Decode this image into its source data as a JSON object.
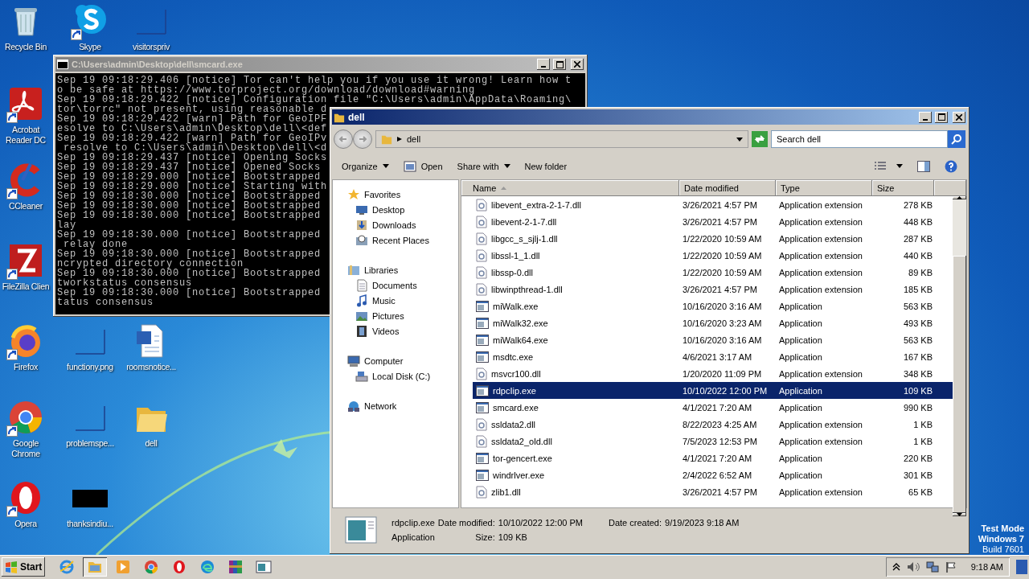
{
  "desktop_icons": [
    {
      "label": "Recycle Bin",
      "kind": "recycle",
      "shortcut": false
    },
    {
      "label": "Skype",
      "kind": "skype",
      "shortcut": true
    },
    {
      "label": "visitorspriv",
      "kind": "blank",
      "shortcut": false
    },
    {
      "label": "Acrobat Reader DC",
      "kind": "acrobat",
      "shortcut": true
    },
    {
      "label": "CCleaner",
      "kind": "ccleaner",
      "shortcut": true
    },
    {
      "label": "FileZilla Clien",
      "kind": "filezilla",
      "shortcut": true
    },
    {
      "label": "Firefox",
      "kind": "firefox",
      "shortcut": true
    },
    {
      "label": "functiony.png",
      "kind": "blank",
      "shortcut": false
    },
    {
      "label": "roomsnotice...",
      "kind": "word",
      "shortcut": false
    },
    {
      "label": "Google Chrome",
      "kind": "chrome",
      "shortcut": true
    },
    {
      "label": "problemspe...",
      "kind": "blank",
      "shortcut": false
    },
    {
      "label": "dell",
      "kind": "folder",
      "shortcut": false
    },
    {
      "label": "Opera",
      "kind": "opera",
      "shortcut": true
    },
    {
      "label": "thanksindiu...",
      "kind": "black",
      "shortcut": false
    }
  ],
  "console": {
    "title": "C:\\Users\\admin\\Desktop\\dell\\smcard.exe",
    "lines": [
      "Sep 19 09:18:29.406 [notice] Tor can't help you if you use it wrong! Learn how t",
      "o be safe at https://www.torproject.org/download/download#warning",
      "Sep 19 09:18:29.422 [notice] Configuration file \"C:\\Users\\admin\\AppData\\Roaming\\",
      "tor\\torrc\" not present, using reasonable d",
      "Sep 19 09:18:29.422 [warn] Path for GeoIPF",
      "esolve to C:\\Users\\admin\\Desktop\\dell\\<def",
      "Sep 19 09:18:29.422 [warn] Path for GeoIPv",
      " resolve to C:\\Users\\admin\\Desktop\\dell\\<d",
      "Sep 19 09:18:29.437 [notice] Opening Socks",
      "Sep 19 09:18:29.437 [notice] Opened Socks",
      "Sep 19 09:18:29.000 [notice] Bootstrapped",
      "Sep 19 09:18:29.000 [notice] Starting with",
      "Sep 19 09:18:30.000 [notice] Bootstrapped",
      "Sep 19 09:18:30.000 [notice] Bootstrapped",
      "Sep 19 09:18:30.000 [notice] Bootstrapped",
      "lay",
      "Sep 19 09:18:30.000 [notice] Bootstrapped",
      " relay done",
      "Sep 19 09:18:30.000 [notice] Bootstrapped",
      "ncrypted directory connection",
      "Sep 19 09:18:30.000 [notice] Bootstrapped",
      "tworkstatus consensus",
      "Sep 19 09:18:30.000 [notice] Bootstrapped",
      "tatus consensus"
    ]
  },
  "explorer": {
    "title": "dell",
    "address": "dell",
    "search_placeholder": "Search dell",
    "toolbar": [
      {
        "label": "Organize",
        "kind": "menu"
      },
      {
        "label": "Open",
        "kind": "open"
      },
      {
        "label": "Share with",
        "kind": "menu"
      },
      {
        "label": "New folder",
        "kind": "plain"
      }
    ],
    "nav": [
      {
        "label": "Favorites",
        "kind": "star",
        "children": [
          {
            "label": "Desktop",
            "kind": "desktop"
          },
          {
            "label": "Downloads",
            "kind": "downloads"
          },
          {
            "label": "Recent Places",
            "kind": "recent"
          }
        ]
      },
      {
        "label": "Libraries",
        "kind": "libraries",
        "children": [
          {
            "label": "Documents",
            "kind": "documents"
          },
          {
            "label": "Music",
            "kind": "music"
          },
          {
            "label": "Pictures",
            "kind": "pictures"
          },
          {
            "label": "Videos",
            "kind": "videos"
          }
        ]
      },
      {
        "label": "Computer",
        "kind": "computer",
        "children": [
          {
            "label": "Local Disk (C:)",
            "kind": "disk"
          }
        ]
      },
      {
        "label": "Network",
        "kind": "network"
      }
    ],
    "columns": [
      {
        "label": "Name",
        "sorted": true
      },
      {
        "label": "Date modified",
        "sorted": false
      },
      {
        "label": "Type",
        "sorted": false
      },
      {
        "label": "Size",
        "sorted": false
      }
    ],
    "files": [
      {
        "name": "libevent_extra-2-1-7.dll",
        "date": "3/26/2021 4:57 PM",
        "type": "Application extension",
        "size": "278 KB",
        "kind": "dll",
        "selected": false
      },
      {
        "name": "libevent-2-1-7.dll",
        "date": "3/26/2021 4:57 PM",
        "type": "Application extension",
        "size": "448 KB",
        "kind": "dll",
        "selected": false
      },
      {
        "name": "libgcc_s_sjlj-1.dll",
        "date": "1/22/2020 10:59 AM",
        "type": "Application extension",
        "size": "287 KB",
        "kind": "dll",
        "selected": false
      },
      {
        "name": "libssl-1_1.dll",
        "date": "1/22/2020 10:59 AM",
        "type": "Application extension",
        "size": "440 KB",
        "kind": "dll",
        "selected": false
      },
      {
        "name": "libssp-0.dll",
        "date": "1/22/2020 10:59 AM",
        "type": "Application extension",
        "size": "89 KB",
        "kind": "dll",
        "selected": false
      },
      {
        "name": "libwinpthread-1.dll",
        "date": "3/26/2021 4:57 PM",
        "type": "Application extension",
        "size": "185 KB",
        "kind": "dll",
        "selected": false
      },
      {
        "name": "miWalk.exe",
        "date": "10/16/2020 3:16 AM",
        "type": "Application",
        "size": "563 KB",
        "kind": "exe",
        "selected": false
      },
      {
        "name": "miWalk32.exe",
        "date": "10/16/2020 3:23 AM",
        "type": "Application",
        "size": "493 KB",
        "kind": "exe",
        "selected": false
      },
      {
        "name": "miWalk64.exe",
        "date": "10/16/2020 3:16 AM",
        "type": "Application",
        "size": "563 KB",
        "kind": "exe",
        "selected": false
      },
      {
        "name": "msdtc.exe",
        "date": "4/6/2021 3:17 AM",
        "type": "Application",
        "size": "167 KB",
        "kind": "exe",
        "selected": false
      },
      {
        "name": "msvcr100.dll",
        "date": "1/20/2020 11:09 PM",
        "type": "Application extension",
        "size": "348 KB",
        "kind": "dll",
        "selected": false
      },
      {
        "name": "rdpcIip.exe",
        "date": "10/10/2022 12:00 PM",
        "type": "Application",
        "size": "109 KB",
        "kind": "exe",
        "selected": true
      },
      {
        "name": "smcard.exe",
        "date": "4/1/2021 7:20 AM",
        "type": "Application",
        "size": "990 KB",
        "kind": "exe",
        "selected": false
      },
      {
        "name": "ssldata2.dll",
        "date": "8/22/2023 4:25 AM",
        "type": "Application extension",
        "size": "1 KB",
        "kind": "dll",
        "selected": false
      },
      {
        "name": "ssldata2_old.dll",
        "date": "7/5/2023 12:53 PM",
        "type": "Application extension",
        "size": "1 KB",
        "kind": "dll",
        "selected": false
      },
      {
        "name": "tor-gencert.exe",
        "date": "4/1/2021 7:20 AM",
        "type": "Application",
        "size": "220 KB",
        "kind": "exe",
        "selected": false
      },
      {
        "name": "windrlver.exe",
        "date": "2/4/2022 6:52 AM",
        "type": "Application",
        "size": "301 KB",
        "kind": "exe",
        "selected": false
      },
      {
        "name": "zlib1.dll",
        "date": "3/26/2021 4:57 PM",
        "type": "Application extension",
        "size": "65 KB",
        "kind": "dll",
        "selected": false
      }
    ],
    "details": {
      "name": "rdpcIip.exe",
      "type": "Application",
      "modified_label": "Date modified:",
      "modified": "10/10/2022 12:00 PM",
      "created_label": "Date created:",
      "created": "9/19/2023 9:18 AM",
      "size_label": "Size:",
      "size": "109 KB"
    }
  },
  "os_notice": [
    "Test Mode",
    "Windows 7",
    "Build 7601"
  ],
  "taskbar": {
    "start": "Start",
    "apps": [
      {
        "kind": "ie",
        "active": false
      },
      {
        "kind": "explorer",
        "active": true
      },
      {
        "kind": "media",
        "active": false
      },
      {
        "kind": "chrome",
        "active": false
      },
      {
        "kind": "opera",
        "active": false
      },
      {
        "kind": "edge",
        "active": false
      },
      {
        "kind": "winrar",
        "active": false
      },
      {
        "kind": "window",
        "active": false
      }
    ],
    "time": "9:18 AM"
  }
}
